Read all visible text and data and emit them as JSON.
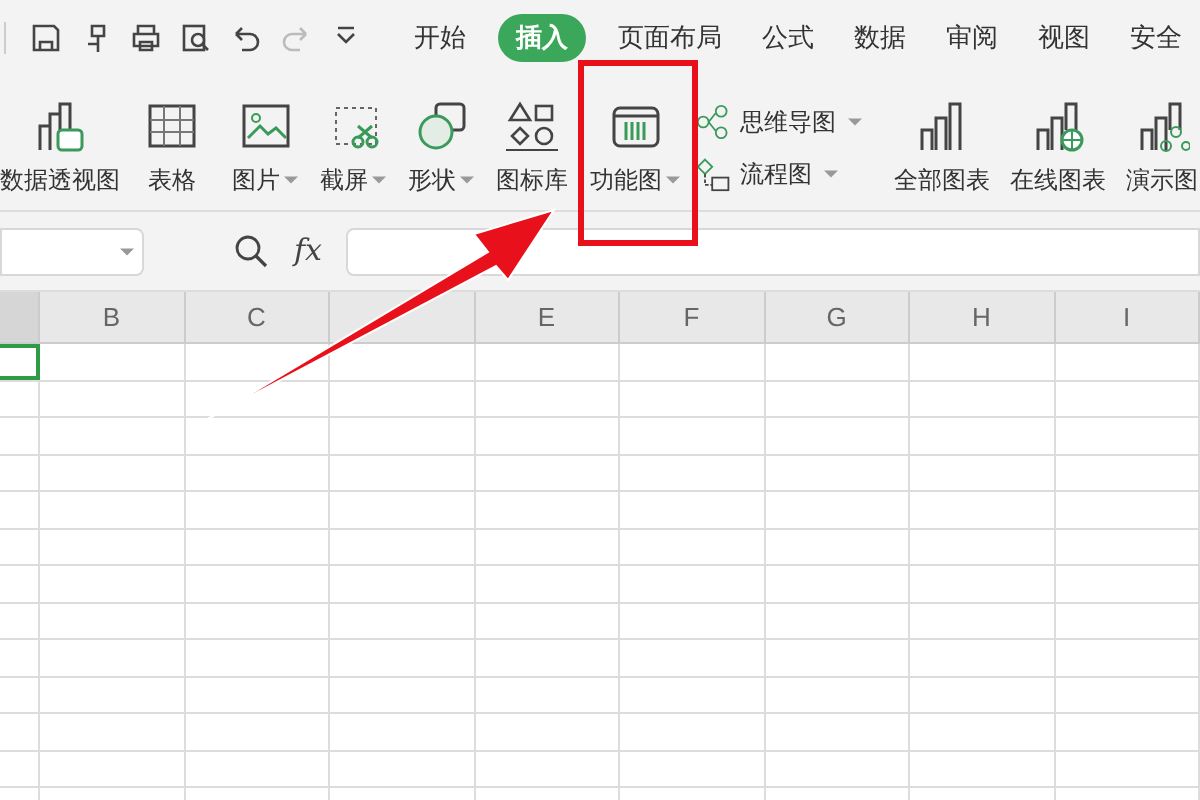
{
  "menu_tabs": [
    {
      "label": "开始",
      "selected": false
    },
    {
      "label": "插入",
      "selected": true
    },
    {
      "label": "页面布局",
      "selected": false
    },
    {
      "label": "公式",
      "selected": false
    },
    {
      "label": "数据",
      "selected": false
    },
    {
      "label": "审阅",
      "selected": false
    },
    {
      "label": "视图",
      "selected": false
    },
    {
      "label": "安全",
      "selected": false
    }
  ],
  "ribbon": {
    "groups": [
      [
        {
          "label": "数据透视图",
          "kind": "button"
        },
        {
          "label": "表格",
          "kind": "button"
        }
      ],
      [
        {
          "label": "图片",
          "kind": "dropdown"
        },
        {
          "label": "截屏",
          "kind": "dropdown"
        },
        {
          "label": "形状",
          "kind": "dropdown"
        },
        {
          "label": "图标库",
          "kind": "button"
        },
        {
          "label": "功能图",
          "kind": "dropdown"
        }
      ],
      [
        {
          "label": "思维导图",
          "kind": "small-dropdown"
        },
        {
          "label": "流程图",
          "kind": "small-dropdown"
        }
      ],
      [
        {
          "label": "全部图表",
          "kind": "button"
        },
        {
          "label": "在线图表",
          "kind": "button"
        },
        {
          "label": "演示图",
          "kind": "button"
        }
      ]
    ]
  },
  "formula_bar": {
    "fx": "fx"
  },
  "sheet": {
    "columns": [
      {
        "label": "B"
      },
      {
        "label": "C"
      },
      {},
      {
        "label": "E"
      },
      {
        "label": "F"
      },
      {
        "label": "G"
      },
      {
        "label": "H"
      },
      {
        "label": "I"
      }
    ],
    "active_cell_shown": true
  },
  "annotation": {
    "highlight": true,
    "arrow": true
  }
}
